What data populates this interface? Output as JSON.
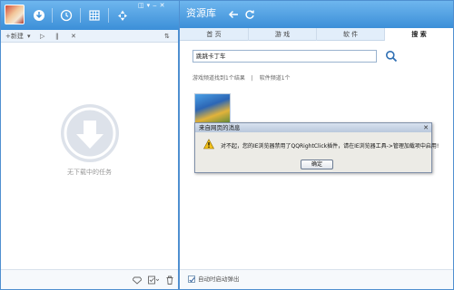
{
  "left": {
    "toolbar": {
      "new_label": "+新建"
    },
    "empty_text": "无下载中的任务"
  },
  "right": {
    "title": "资源库",
    "tabs": [
      {
        "label": "首 页",
        "active": false
      },
      {
        "label": "游 戏",
        "active": false
      },
      {
        "label": "软 件",
        "active": false
      },
      {
        "label": "搜 索",
        "active": true
      }
    ],
    "search": {
      "value": "跳跳卡丁车"
    },
    "results": {
      "games": "游戏频道找到1个结果",
      "separator": "|",
      "software": "软件频道1个"
    },
    "auto_close_label": "自动时启动弹出"
  },
  "dialog": {
    "title": "来自网页的消息",
    "message": "对不起，您的IE浏览器禁用了QQRightClick插件，请在IE浏览器工具->管理加载项中启用!",
    "ok_label": "确定"
  },
  "colors": {
    "accent": "#3c8fd8",
    "header_light": "#6eb6ee"
  }
}
